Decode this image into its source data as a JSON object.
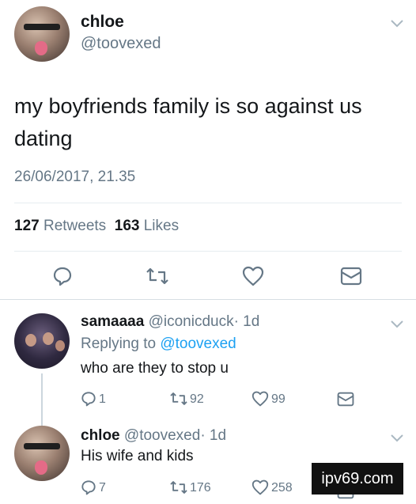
{
  "tweet": {
    "display_name": "chloe",
    "handle": "@toovexed",
    "text": "my boyfriends family is so against us dating",
    "timestamp": "26/06/2017, 21.35",
    "retweets_count": "127",
    "retweets_label": "Retweets",
    "likes_count": "163",
    "likes_label": "Likes"
  },
  "replies": [
    {
      "display_name": "samaaaa",
      "handle": "@iconicduck",
      "age": "· 1d",
      "replying_prefix": "Replying to",
      "replying_to": "@toovexed",
      "text": "who are they to stop u",
      "reply_count": "1",
      "retweet_count": "92",
      "like_count": "99"
    },
    {
      "display_name": "chloe",
      "handle": "@toovexed",
      "age": "· 1d",
      "text": "His wife and kids",
      "reply_count": "7",
      "retweet_count": "176",
      "like_count": "258"
    }
  ],
  "watermark": "ipv69.com",
  "icons": [
    "reply-icon",
    "retweet-icon",
    "like-icon",
    "message-icon",
    "chevron-down-icon"
  ],
  "colors": {
    "link": "#1da1f2",
    "muted": "#657786",
    "text": "#14171a"
  }
}
